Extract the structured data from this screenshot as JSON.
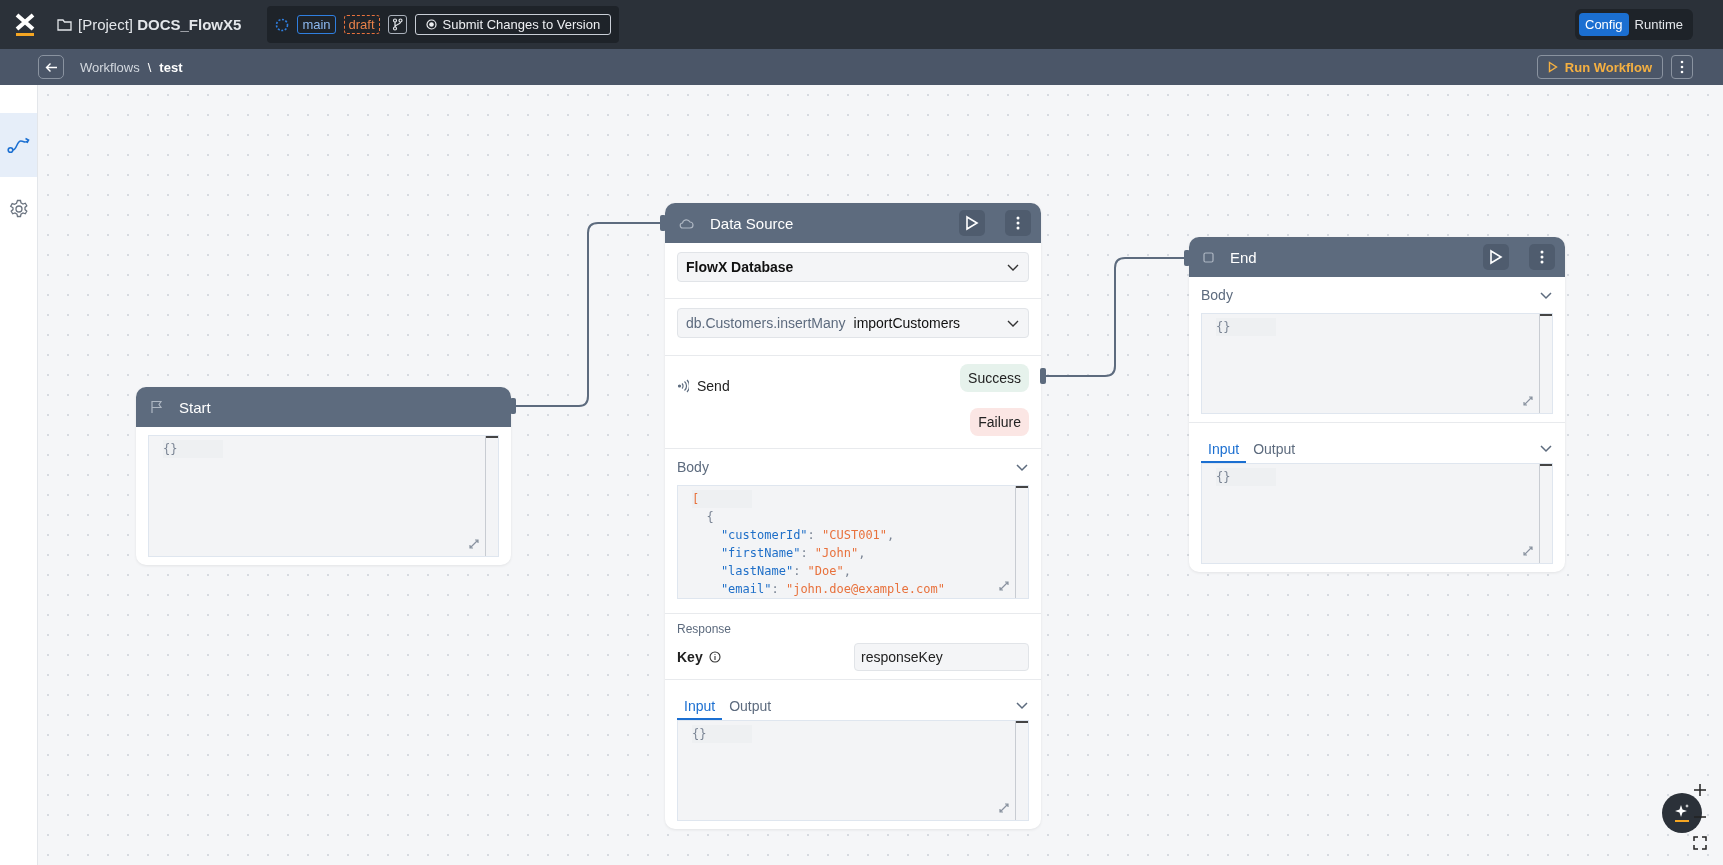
{
  "topbar": {
    "project": "[Project] **DOCS_FlowX5**",
    "branch": "main",
    "status": "draft",
    "submit_button": "Submit Changes to Version",
    "mode_toggle": [
      {
        "label": "Config",
        "selected": true
      },
      {
        "label": "Runtime",
        "selected": false
      }
    ]
  },
  "subbar": {
    "breadcrumb": "Workflows",
    "separator": "\\",
    "current": "test",
    "run_button": "Run Workflow"
  },
  "sidebar": {
    "items": [
      {
        "kind": "workflow",
        "selected": true
      },
      {
        "kind": "settings",
        "selected": false
      }
    ]
  },
  "start_node": {
    "title": "Start",
    "editor": [
      [
        {
          "kind": "punct",
          "text": "{}"
        }
      ]
    ]
  },
  "data_source_node": {
    "title": "Data Source",
    "source": "FlowX Database",
    "operation_method": "db.Customers.insertMany",
    "operation_name": "importCustomers",
    "send_label": "Send",
    "outcomes": [
      {
        "kind": "success",
        "label": "Success"
      },
      {
        "kind": "failure",
        "label": "Failure"
      }
    ],
    "body_label": "Body",
    "body_editor": [
      [
        {
          "kind": "bracket",
          "text": "["
        }
      ],
      [
        {
          "kind": "punct",
          "text": "  {"
        }
      ],
      [
        {
          "kind": "key",
          "text": "    \"customerId\""
        },
        {
          "kind": "punct",
          "text": ": "
        },
        {
          "kind": "string",
          "text": "\"CUST001\""
        },
        {
          "kind": "punct",
          "text": ","
        }
      ],
      [
        {
          "kind": "key",
          "text": "    \"firstName\""
        },
        {
          "kind": "punct",
          "text": ": "
        },
        {
          "kind": "string",
          "text": "\"John\""
        },
        {
          "kind": "punct",
          "text": ","
        }
      ],
      [
        {
          "kind": "key",
          "text": "    \"lastName\""
        },
        {
          "kind": "punct",
          "text": ": "
        },
        {
          "kind": "string",
          "text": "\"Doe\""
        },
        {
          "kind": "punct",
          "text": ","
        }
      ],
      [
        {
          "kind": "key",
          "text": "    \"email\""
        },
        {
          "kind": "punct",
          "text": ": "
        },
        {
          "kind": "string",
          "text": "\"john.doe@example.com\""
        }
      ]
    ],
    "response_label": "Response",
    "key_label": "Key",
    "key_value": "responseKey",
    "io_tabs": [
      {
        "label": "Input",
        "selected": true
      },
      {
        "label": "Output",
        "selected": false
      }
    ],
    "io_editor": [
      [
        {
          "kind": "punct",
          "text": "{}"
        }
      ]
    ]
  },
  "end_node": {
    "title": "End",
    "body_label": "Body",
    "body_editor": [
      [
        {
          "kind": "punct",
          "text": "{}"
        }
      ]
    ],
    "io_tabs": [
      {
        "label": "Input",
        "selected": true
      },
      {
        "label": "Output",
        "selected": false
      }
    ],
    "io_editor": [
      [
        {
          "kind": "punct",
          "text": "{}"
        }
      ]
    ]
  }
}
